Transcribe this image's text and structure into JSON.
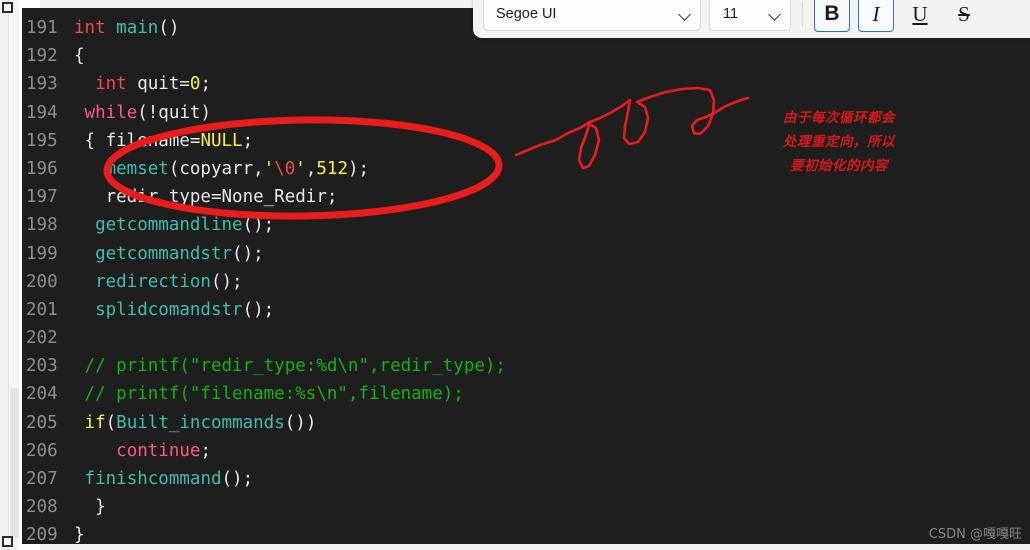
{
  "toolbar": {
    "font_name": "Segoe UI",
    "font_size": "11",
    "bold_label": "B",
    "italic_label": "I",
    "underline_label": "U",
    "strikethrough_label": "S",
    "active_accent": "#2a72c8"
  },
  "editor": {
    "background": "#1e1e1e",
    "line_number_color": "#8e8e8e",
    "first_line": 191,
    "lines": [
      {
        "n": "191",
        "tokens": [
          {
            "t": "int",
            "c": "t-kw-red"
          },
          {
            "t": " ",
            "c": "t-plain"
          },
          {
            "t": "main",
            "c": "t-fn"
          },
          {
            "t": "()",
            "c": "t-punc"
          }
        ]
      },
      {
        "n": "192",
        "tokens": [
          {
            "t": "{",
            "c": "t-punc"
          }
        ]
      },
      {
        "n": "193",
        "tokens": [
          {
            "t": "  ",
            "c": "t-plain"
          },
          {
            "t": "int",
            "c": "t-kw-red"
          },
          {
            "t": " quit=",
            "c": "t-plain"
          },
          {
            "t": "0",
            "c": "t-num"
          },
          {
            "t": ";",
            "c": "t-punc"
          }
        ]
      },
      {
        "n": "194",
        "tokens": [
          {
            "t": " ",
            "c": "t-plain"
          },
          {
            "t": "while",
            "c": "t-kw-pink"
          },
          {
            "t": "(!quit)",
            "c": "t-punc"
          }
        ]
      },
      {
        "n": "195",
        "tokens": [
          {
            "t": " {",
            "c": "t-punc"
          },
          {
            "t": " filename=",
            "c": "t-plain"
          },
          {
            "t": "NULL",
            "c": "t-num"
          },
          {
            "t": ";",
            "c": "t-punc"
          }
        ]
      },
      {
        "n": "196",
        "tokens": [
          {
            "t": "   ",
            "c": "t-plain"
          },
          {
            "t": "memset",
            "c": "t-teal"
          },
          {
            "t": "(copyarr,",
            "c": "t-punc"
          },
          {
            "t": "'",
            "c": "t-str"
          },
          {
            "t": "\\0",
            "c": "t-esc"
          },
          {
            "t": "'",
            "c": "t-str"
          },
          {
            "t": ",",
            "c": "t-punc"
          },
          {
            "t": "512",
            "c": "t-num"
          },
          {
            "t": ");",
            "c": "t-punc"
          }
        ]
      },
      {
        "n": "197",
        "tokens": [
          {
            "t": "   redir_type=None_Redir;",
            "c": "t-plain"
          }
        ]
      },
      {
        "n": "198",
        "tokens": [
          {
            "t": "  ",
            "c": "t-plain"
          },
          {
            "t": "getcommandline",
            "c": "t-teal"
          },
          {
            "t": "();",
            "c": "t-punc"
          }
        ]
      },
      {
        "n": "199",
        "tokens": [
          {
            "t": "  ",
            "c": "t-plain"
          },
          {
            "t": "getcommandstr",
            "c": "t-teal"
          },
          {
            "t": "();",
            "c": "t-punc"
          }
        ]
      },
      {
        "n": "200",
        "tokens": [
          {
            "t": "  ",
            "c": "t-plain"
          },
          {
            "t": "redirection",
            "c": "t-teal"
          },
          {
            "t": "();",
            "c": "t-punc"
          }
        ]
      },
      {
        "n": "201",
        "tokens": [
          {
            "t": "  ",
            "c": "t-plain"
          },
          {
            "t": "splidcomandstr",
            "c": "t-teal"
          },
          {
            "t": "();",
            "c": "t-punc"
          }
        ]
      },
      {
        "n": "202",
        "tokens": [
          {
            "t": "",
            "c": "t-plain"
          }
        ]
      },
      {
        "n": "203",
        "tokens": [
          {
            "t": " // printf(\"redir_type:%d\\n\",redir_type);",
            "c": "t-comment"
          }
        ]
      },
      {
        "n": "204",
        "tokens": [
          {
            "t": " // printf(\"filename:%s\\n\",filename);",
            "c": "t-comment"
          }
        ]
      },
      {
        "n": "205",
        "tokens": [
          {
            "t": " ",
            "c": "t-plain"
          },
          {
            "t": "if",
            "c": "t-kw-yellow"
          },
          {
            "t": "(",
            "c": "t-punc"
          },
          {
            "t": "Built_incommands",
            "c": "t-teal"
          },
          {
            "t": "())",
            "c": "t-punc"
          }
        ]
      },
      {
        "n": "206",
        "tokens": [
          {
            "t": "    ",
            "c": "t-plain"
          },
          {
            "t": "continue",
            "c": "t-kw-pink"
          },
          {
            "t": ";",
            "c": "t-punc"
          }
        ]
      },
      {
        "n": "207",
        "tokens": [
          {
            "t": " ",
            "c": "t-plain"
          },
          {
            "t": "finishcommand",
            "c": "t-teal"
          },
          {
            "t": "();",
            "c": "t-punc"
          }
        ]
      },
      {
        "n": "208",
        "tokens": [
          {
            "t": "  }",
            "c": "t-punc"
          }
        ]
      },
      {
        "n": "209",
        "tokens": [
          {
            "t": "}",
            "c": "t-punc"
          }
        ]
      }
    ]
  },
  "annotation": {
    "ink_color": "#ea1c1c",
    "note_line_1": "由于每次循环都会",
    "note_line_2": "处理重定向，所以",
    "note_line_3": "要初始化的内容"
  },
  "watermark": {
    "text": "CSDN @嘎嘎旺"
  }
}
